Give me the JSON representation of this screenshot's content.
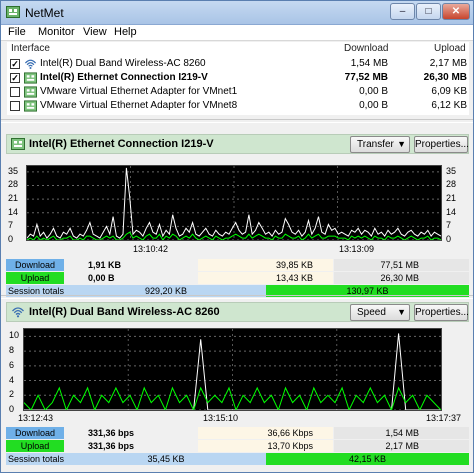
{
  "window": {
    "title": "NetMet",
    "controls": {
      "minimize": "–",
      "maximize": "□",
      "close": "✕"
    }
  },
  "menu": [
    "File",
    "Monitor",
    "View",
    "Help"
  ],
  "table": {
    "headers": {
      "interface": "Interface",
      "download": "Download",
      "upload": "Upload"
    },
    "rows": [
      {
        "checked": true,
        "icon": "wifi-icon",
        "name": "Intel(R) Dual Band Wireless-AC 8260",
        "download": "1,54 MB",
        "upload": "2,17 MB",
        "bold": false
      },
      {
        "checked": true,
        "icon": "network-adapter-icon",
        "name": "Intel(R) Ethernet Connection I219-V",
        "download": "77,52 MB",
        "upload": "26,30 MB",
        "bold": true
      },
      {
        "checked": false,
        "icon": "network-adapter-icon",
        "name": "VMware Virtual Ethernet Adapter for VMnet1",
        "download": "0,00 B",
        "upload": "6,09 KB",
        "bold": false
      },
      {
        "checked": false,
        "icon": "network-adapter-icon",
        "name": "VMware Virtual Ethernet Adapter for VMnet8",
        "download": "0,00 B",
        "upload": "6,12 KB",
        "bold": false
      }
    ]
  },
  "panels": [
    {
      "title": "Intel(R) Ethernet Connection I219-V",
      "icon": "network-adapter-icon",
      "mode": "Transfer",
      "properties_label": "Properties...",
      "time_labels": [
        "13:10:42",
        "13:13:09"
      ],
      "stats": {
        "download": {
          "label": "Download",
          "current": "1,91 KB",
          "mid": "39,85 KB",
          "total": "77,51 MB"
        },
        "upload": {
          "label": "Upload",
          "current": "0,00 B",
          "mid": "13,43 KB",
          "total": "26,30 MB"
        },
        "session": {
          "label": "Session totals",
          "left": "929,20 KB",
          "right": "130,97 KB"
        }
      },
      "chart_data": {
        "type": "line",
        "y_ticks": [
          0,
          7,
          14,
          21,
          28,
          35
        ],
        "ylim": [
          0,
          38
        ],
        "series": [
          {
            "color": "#ffffff",
            "values": [
              1,
              3,
              2,
              8,
              2,
              4,
              1,
              3,
              6,
              2,
              1,
              4,
              3,
              6,
              2,
              1,
              3,
              2,
              5,
              9,
              3,
              2,
              1,
              4,
              7,
              3,
              12,
              2,
              1,
              3,
              37,
              22,
              3,
              5,
              4,
              2,
              6,
              9,
              4,
              3,
              8,
              2,
              5,
              3,
              13,
              6,
              2,
              3,
              6,
              4,
              9,
              3,
              2,
              4,
              6,
              3,
              2,
              5,
              3,
              2,
              4,
              3,
              6,
              9,
              5,
              3,
              4,
              13,
              3,
              5,
              9,
              6,
              3,
              4,
              2,
              5,
              3,
              4,
              11,
              8,
              4,
              3,
              5,
              2,
              4,
              10,
              3,
              6,
              12,
              4,
              3,
              8,
              5,
              6,
              3,
              4,
              3,
              2,
              5,
              4,
              6,
              3,
              5,
              4,
              2,
              6,
              3,
              4,
              2,
              5,
              3,
              4,
              6,
              3,
              2,
              4,
              5,
              3,
              2,
              4,
              3,
              5,
              2,
              4,
              3,
              2
            ]
          },
          {
            "color": "#00ff00",
            "values": [
              0,
              1,
              0,
              2,
              0,
              1,
              0,
              1,
              2,
              0,
              0,
              1,
              1,
              2,
              0,
              0,
              1,
              0,
              2,
              2,
              1,
              0,
              0,
              1,
              2,
              1,
              2,
              0,
              0,
              1,
              3,
              4,
              1,
              2,
              1,
              0,
              2,
              3,
              1,
              1,
              3,
              0,
              2,
              1,
              3,
              2,
              0,
              1,
              2,
              1,
              3,
              1,
              0,
              1,
              2,
              1,
              0,
              2,
              1,
              0,
              1,
              1,
              2,
              3,
              2,
              1,
              1,
              3,
              1,
              2,
              3,
              2,
              1,
              1,
              0,
              2,
              1,
              1,
              3,
              2,
              1,
              1,
              2,
              0,
              1,
              3,
              1,
              2,
              3,
              1,
              1,
              2,
              2,
              2,
              1,
              1,
              1,
              0,
              2,
              1,
              2,
              1,
              2,
              1,
              0,
              2,
              1,
              1,
              0,
              2,
              1,
              1,
              2,
              1,
              0,
              1,
              2,
              1,
              0,
              1,
              1,
              2,
              0,
              1,
              1,
              0
            ]
          }
        ]
      }
    },
    {
      "title": "Intel(R) Dual Band Wireless-AC 8260",
      "icon": "wifi-icon",
      "mode": "Speed",
      "properties_label": "Properties...",
      "time_labels": [
        "13:12:43",
        "13:15:10",
        "13:17:37"
      ],
      "stats": {
        "download": {
          "label": "Download",
          "current": "331,36 bps",
          "mid": "36,66 Kbps",
          "total": "1,54 MB"
        },
        "upload": {
          "label": "Upload",
          "current": "331,36 bps",
          "mid": "13,70 Kbps",
          "total": "2,17 MB"
        },
        "session": {
          "label": "Session totals",
          "left": "35,45 KB",
          "right": "42,15 KB"
        }
      },
      "chart_data": {
        "type": "line",
        "y_ticks": [
          0,
          2,
          4,
          6,
          8,
          10
        ],
        "ylim": [
          0,
          11
        ],
        "series": [
          {
            "color": "#ffffff",
            "values": [
              0,
              0,
              0,
              0,
              0,
              0,
              0,
              0,
              0,
              0,
              0,
              0,
              0,
              0,
              0,
              0,
              0,
              0,
              0,
              0,
              0,
              0,
              0,
              0,
              0,
              9.6,
              0,
              0,
              0,
              0,
              0,
              0,
              0,
              0,
              0,
              0,
              0,
              0,
              0,
              0,
              0,
              0,
              0,
              0,
              0,
              0,
              0,
              0,
              0,
              0,
              0,
              0,
              0,
              10.4,
              0,
              0,
              0,
              0,
              0,
              0
            ]
          },
          {
            "color": "#00ff00",
            "values": [
              1,
              0,
              2,
              0,
              1,
              3,
              0,
              2,
              1,
              3,
              0,
              2,
              1,
              3,
              1,
              2,
              0,
              3,
              1,
              2,
              0,
              3,
              1,
              2,
              0,
              3,
              1,
              2,
              1,
              3,
              0,
              2,
              1,
              3,
              1,
              2,
              0,
              3,
              1,
              2,
              0,
              3,
              1,
              2,
              1,
              3,
              0,
              2,
              1,
              3,
              1,
              2,
              0,
              3,
              1,
              2,
              0,
              2,
              1,
              0
            ]
          }
        ]
      }
    }
  ],
  "colors": {
    "download": "#6fb0e8",
    "upload": "#22dd22",
    "session_left": "#b9d6f2",
    "session_right": "#22dd22",
    "mid_bg": "#fdf6e6",
    "total_bg": "#e6e6e6"
  }
}
